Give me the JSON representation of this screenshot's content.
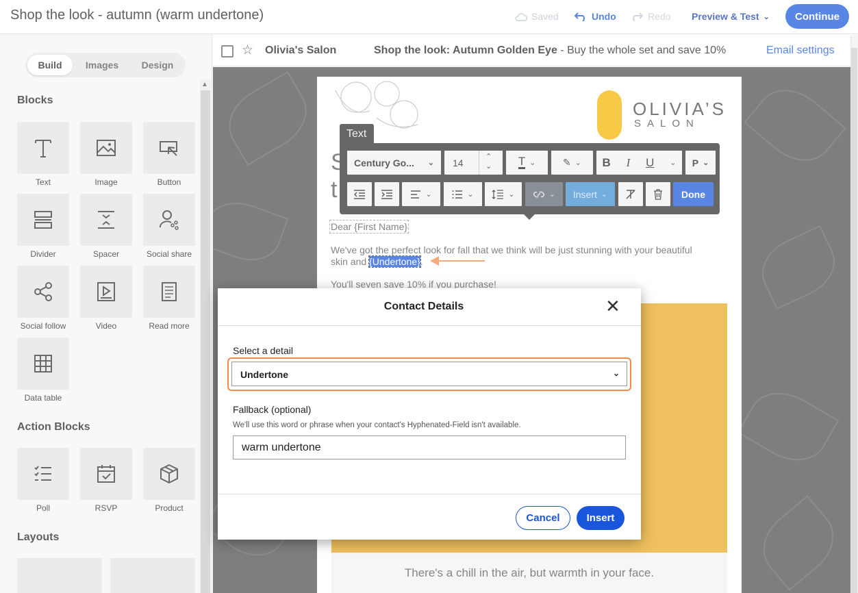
{
  "topbar": {
    "title": "Shop the look - autumn (warm undertone)",
    "saved": "Saved",
    "undo": "Undo",
    "redo": "Redo",
    "preview": "Preview & Test",
    "continue": "Continue",
    "accent_color": "#1a56db"
  },
  "sidebar": {
    "tabs": [
      "Build",
      "Images",
      "Design"
    ],
    "active_tab": "Build",
    "blocks_heading": "Blocks",
    "blocks": [
      {
        "label": "Text",
        "icon": "text-icon"
      },
      {
        "label": "Image",
        "icon": "image-icon"
      },
      {
        "label": "Button",
        "icon": "button-icon"
      },
      {
        "label": "Divider",
        "icon": "divider-icon"
      },
      {
        "label": "Spacer",
        "icon": "spacer-icon"
      },
      {
        "label": "Social share",
        "icon": "social-share-icon"
      },
      {
        "label": "Social follow",
        "icon": "social-follow-icon"
      },
      {
        "label": "Video",
        "icon": "video-icon"
      },
      {
        "label": "Read more",
        "icon": "read-more-icon"
      },
      {
        "label": "Data table",
        "icon": "table-icon"
      }
    ],
    "action_heading": "Action Blocks",
    "action_blocks": [
      {
        "label": "Poll",
        "icon": "poll-icon"
      },
      {
        "label": "RSVP",
        "icon": "calendar-icon"
      },
      {
        "label": "Product",
        "icon": "box-icon"
      }
    ],
    "layouts_heading": "Layouts"
  },
  "email_header": {
    "from": "Olivia's Salon",
    "subject_bold": "Shop the look: Autumn Golden Eye",
    "subject_rest": " - Buy the whole set and save 10%",
    "settings": "Email settings"
  },
  "email": {
    "logo_name": "OLIVIA’S",
    "logo_sub": "SALON",
    "heading_start": "S",
    "heading_start_2": "t",
    "greeting": "Dear {First Name}",
    "body_line1": "We've got the perfect look for fall that we think will be just stunning with your beautiful",
    "body_line2_prefix": "skin and ",
    "highlight": "{Undertone}",
    "body_line2_suffix": ".",
    "body_line3": "You'll seven save 10% if you purchase!",
    "caption": "There's a chill in the air, but warmth in your face."
  },
  "text_toolbar": {
    "tab_label": "Text",
    "font": "Century Go...",
    "size": "14",
    "paragraph": "P",
    "insert": "Insert",
    "done": "Done",
    "accent_color": "#f28a4b"
  },
  "modal": {
    "title": "Contact Details",
    "select_label": "Select a detail",
    "select_value": "Undertone",
    "fallback_label": "Fallback (optional)",
    "fallback_hint": "We'll use this word or phrase when your contact's Hyphenated-Field isn't available.",
    "fallback_value": "warm undertone",
    "cancel": "Cancel",
    "insert": "Insert"
  }
}
